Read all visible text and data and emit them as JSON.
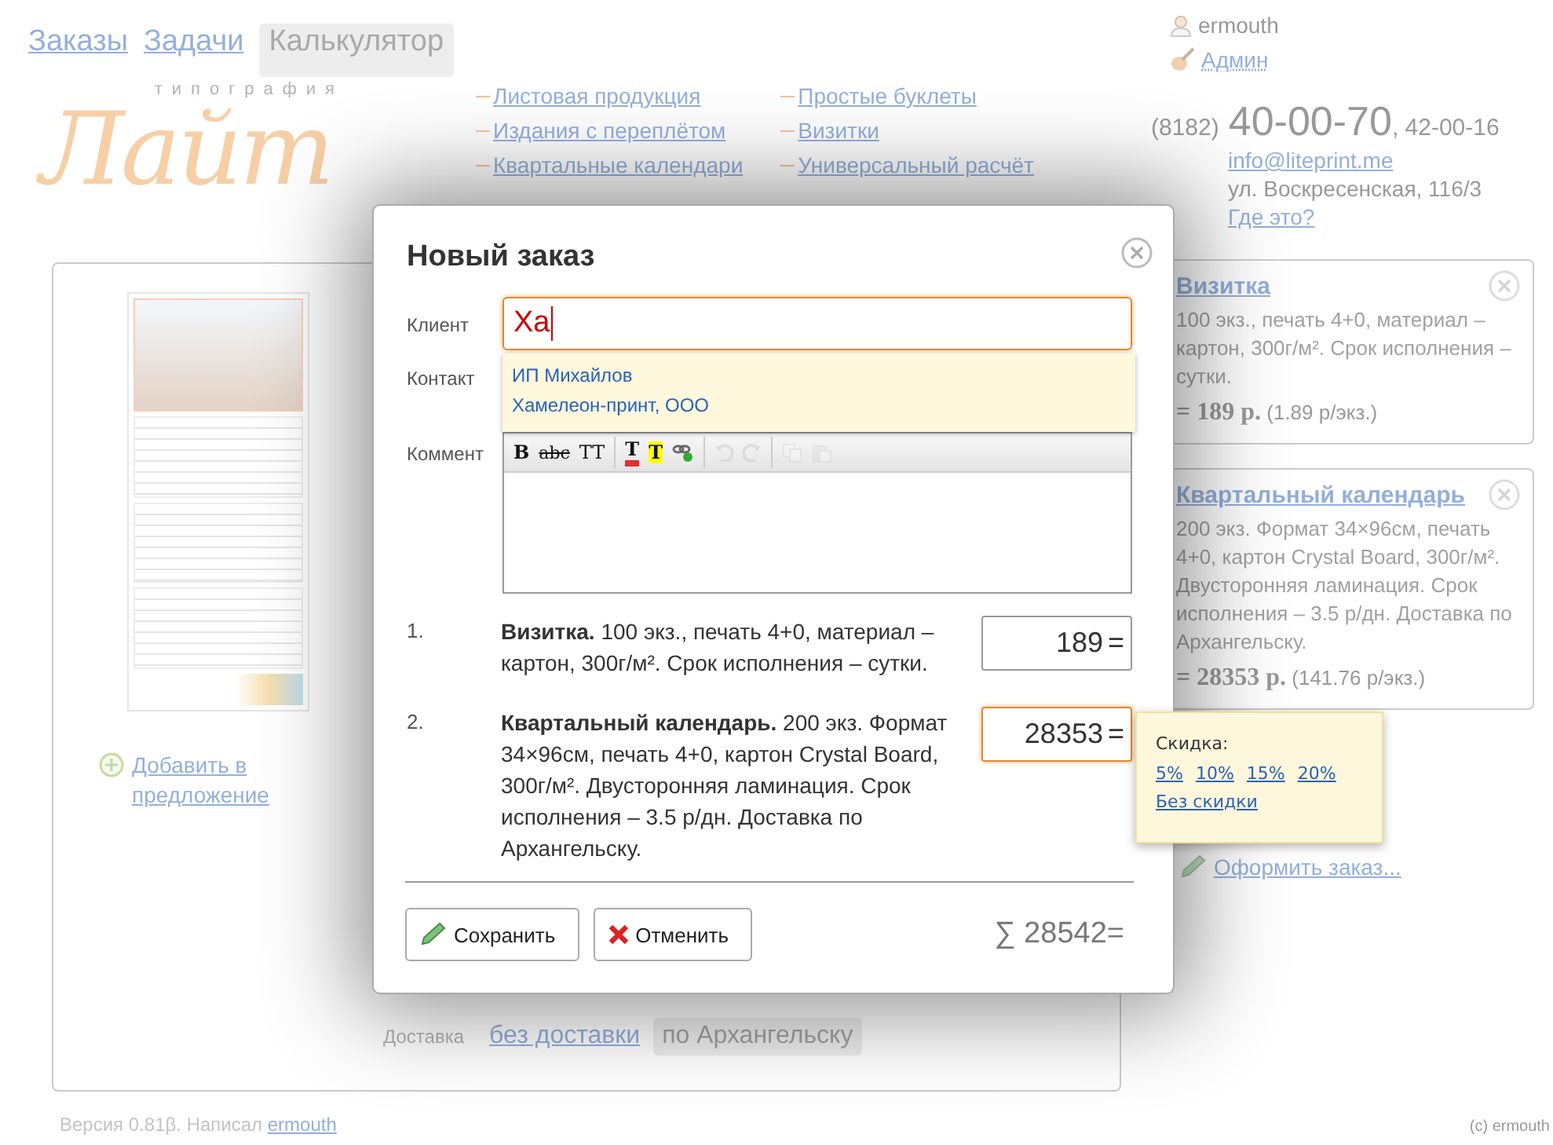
{
  "nav_tabs": [
    {
      "label": "Заказы",
      "selected": false
    },
    {
      "label": "Задачи",
      "selected": false
    },
    {
      "label": "Калькулятор",
      "selected": true
    }
  ],
  "user": {
    "name": "ermouth",
    "role": "Админ"
  },
  "logo": {
    "tagline": "типография",
    "name": "Лайт"
  },
  "product_links": [
    [
      "Листовая продукция",
      "Издания с переплётом",
      "Квартальные календари"
    ],
    [
      "Простые буклеты",
      "Визитки",
      "Универсальный расчёт"
    ]
  ],
  "contact": {
    "area_code": "(8182)",
    "phone": "40-00-70",
    "phone_extra": ", 42-00-16",
    "email": "info@liteprint.me",
    "address": "ул. Воскресенская, 116/3",
    "map_link": "Где это?"
  },
  "preview": {
    "add_link": "Добавить в предложение"
  },
  "delivery": {
    "label": "Доставка",
    "options": [
      {
        "label": "без доставки",
        "selected": false
      },
      {
        "label": "по Архангельску",
        "selected": true
      }
    ]
  },
  "offer_items": [
    {
      "title": "Визитка",
      "description": "100 экз., печать 4+0, материал – картон, 300г/м². Срок исполнения – сутки.",
      "total": "= 189 р.",
      "unit_price": "(1.89 р/экз.)"
    },
    {
      "title": "Квартальный календарь",
      "description": "200 экз. Формат 34×96см, печать 4+0, картон Crystal Board, 300г/м². Двусторонняя ламинация. Срок исполнения – 3.5 р/дн. Доставка по Архангельску.",
      "total": "= 28353 р.",
      "unit_price": "(141.76 р/экз.)"
    }
  ],
  "order_link": "Оформить заказ...",
  "footer": {
    "version": "Версия 0.81β. Написал",
    "author": "ermouth",
    "copyright": "(c) ermouth"
  },
  "modal": {
    "title": "Новый заказ",
    "client_label": "Клиент",
    "client_value": "Ха",
    "contact_label": "Контакт",
    "comment_label": "Коммент",
    "suggestions": [
      "ИП Михайлов",
      "Хамелеон-принт, ООО"
    ],
    "toolbar": [
      {
        "kind": "bold",
        "glyph": "B",
        "disabled": false
      },
      {
        "kind": "strike",
        "glyph": "abc",
        "disabled": false
      },
      {
        "kind": "size",
        "glyph": "TT",
        "disabled": false
      },
      {
        "kind": "color",
        "glyph": "T",
        "disabled": false
      },
      {
        "kind": "highlight",
        "glyph": "T",
        "disabled": false
      },
      {
        "kind": "link",
        "disabled": false
      },
      {
        "kind": "undo",
        "disabled": true
      },
      {
        "kind": "redo",
        "disabled": true
      },
      {
        "kind": "copy",
        "disabled": true
      },
      {
        "kind": "paste",
        "disabled": true
      }
    ],
    "items": [
      {
        "number": "1.",
        "text": "**Визитка.** 100 экз., печать 4+0, материал – картон, 300г/м². Срок исполнения – сутки.",
        "price": "189",
        "suffix": "=",
        "focused": false
      },
      {
        "number": "2.",
        "text": "**Квартальный календарь.** 200 экз. Формат 34×96см, печать 4+0, картон Crystal Board, 300г/м². Двусторонняя ламинация. Срок исполнения – 3.5 р/дн. Доставка по Архангельску.",
        "price": "28353",
        "suffix": "=",
        "focused": true
      }
    ],
    "buttons": [
      {
        "kind": "save",
        "label": "Сохранить"
      },
      {
        "kind": "cancel",
        "label": "Отменить"
      }
    ],
    "total": "∑ 28542="
  },
  "discount": {
    "title": "Скидка:",
    "options": [
      "5%",
      "10%",
      "15%",
      "20%"
    ],
    "none": "Без скидки"
  }
}
